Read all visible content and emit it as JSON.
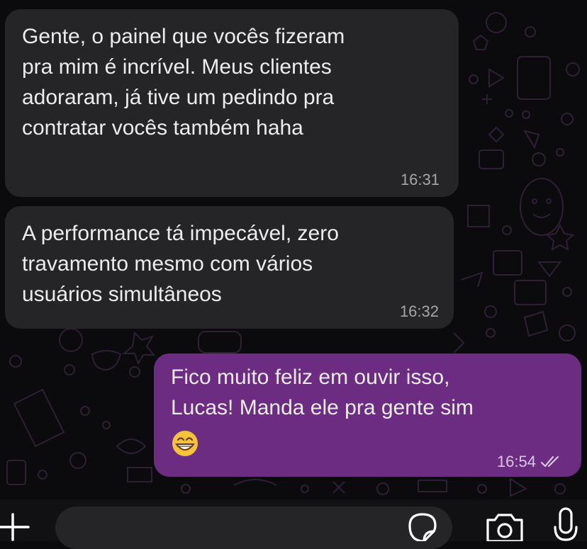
{
  "colors": {
    "incoming_bubble": "#252527",
    "outgoing_bubble": "#6c2c82",
    "wallpaper_doodle": "#2e1f35"
  },
  "messages": [
    {
      "direction": "incoming",
      "text": "Gente, o painel que vocês fizeram\npra mim é incrível. Meus clientes\nadoraram, já tive um pedindo pra\ncontratar vocês também haha",
      "time": "16:31"
    },
    {
      "direction": "incoming",
      "text": "A performance tá impecável, zero\ntravamento mesmo com vários\nusuários simultâneos",
      "time": "16:32"
    },
    {
      "direction": "outgoing",
      "text": "Fico muito feliz em ouvir isso,\nLucas! Manda ele pra gente sim",
      "emoji": "grinning-face",
      "time": "16:54",
      "status": "read"
    }
  ],
  "composer": {
    "value": "",
    "attach_icon": "plus-icon",
    "sticker_icon": "sticker-icon",
    "camera_icon": "camera-icon",
    "mic_icon": "microphone-icon"
  }
}
